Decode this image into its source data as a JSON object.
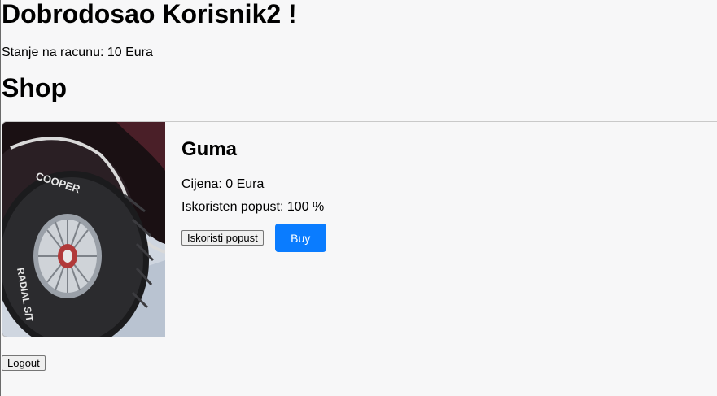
{
  "header": {
    "welcome": "Dobrodosao Korisnik2 !",
    "balance": "Stanje na racunu: 10 Eura"
  },
  "shop": {
    "title": "Shop",
    "product": {
      "name": "Guma",
      "price": "Cijena: 0 Eura",
      "discount_used": "Iskoristen popust: 100 %",
      "apply_discount_label": "Iskoristi popust",
      "buy_label": "Buy",
      "image_alt": "tire-photo"
    }
  },
  "footer": {
    "logout_label": "Logout"
  },
  "colors": {
    "buy_button": "#0a7cff",
    "background": "#f7f7f8"
  }
}
